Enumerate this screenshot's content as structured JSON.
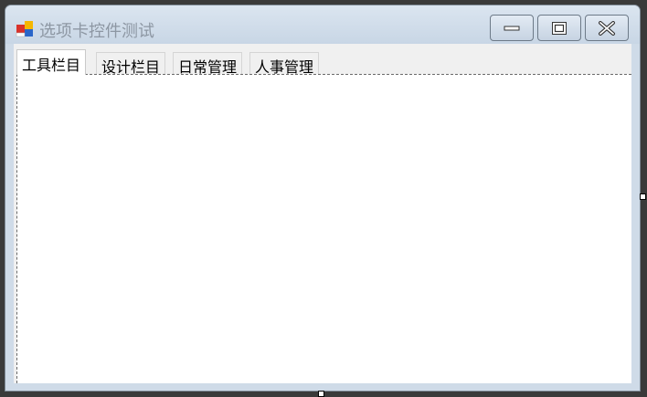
{
  "window": {
    "title": "选项卡控件测试",
    "icon": "windows-form-icon"
  },
  "controls": {
    "minimize_icon": "minimize-icon",
    "maximize_icon": "maximize-icon",
    "close_icon": "close-icon"
  },
  "tabs": [
    {
      "label": "工具栏目",
      "active": true
    },
    {
      "label": "设计栏目",
      "active": false
    },
    {
      "label": "日常管理",
      "active": false
    },
    {
      "label": "人事管理",
      "active": false
    }
  ],
  "colors": {
    "titlebar": "#cfdbe8",
    "frame": "#3a3a3a",
    "title_text": "#8d97a3"
  }
}
